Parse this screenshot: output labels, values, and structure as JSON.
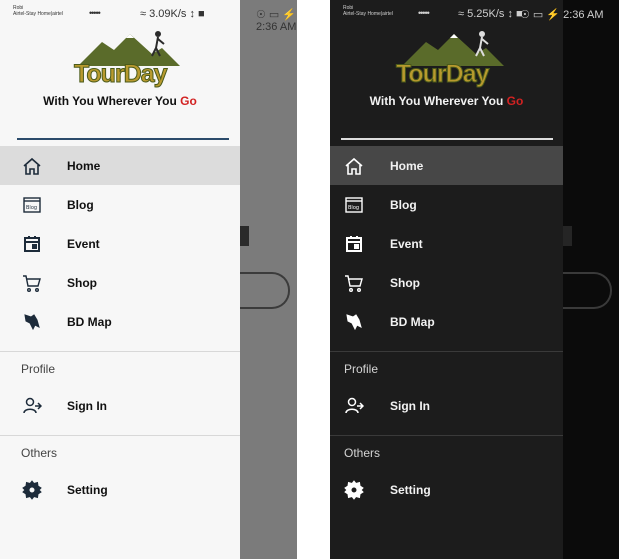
{
  "light": {
    "status": {
      "carrier": "Robi\nAirtel-Stay Home|airtel",
      "signal": "•••••",
      "speed": "≈ 3.09K/s ↕ ■",
      "time": "☉ ▭ ⚡ 2:36 AM"
    }
  },
  "dark": {
    "status": {
      "carrier": "Robi\nAirtel-Stay Home|airtel",
      "signal": "•••••",
      "speed": "≈ 5.25K/s ↕ ■",
      "time": "☉ ▭ ⚡ 2:36 AM"
    }
  },
  "brand": {
    "logo_text": "TourDay",
    "tagline_main": "With You Wherever You ",
    "tagline_accent": "Go",
    "accent_color": "#d22222"
  },
  "menu": {
    "items": [
      {
        "label": "Home",
        "icon": "home-icon"
      },
      {
        "label": "Blog",
        "icon": "blog-icon"
      },
      {
        "label": "Event",
        "icon": "calendar-icon"
      },
      {
        "label": "Shop",
        "icon": "cart-icon"
      },
      {
        "label": "BD Map",
        "icon": "map-icon"
      }
    ],
    "profile_section": "Profile",
    "profile_items": [
      {
        "label": "Sign In",
        "icon": "sign-in-icon"
      }
    ],
    "others_section": "Others",
    "others_items": [
      {
        "label": "Setting",
        "icon": "gear-icon"
      }
    ]
  },
  "blog_icon_text": "Blog"
}
